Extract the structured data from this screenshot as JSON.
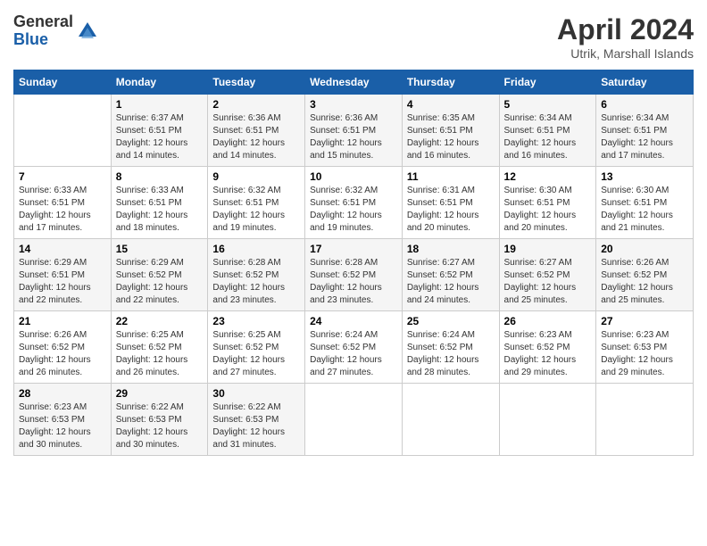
{
  "logo": {
    "general": "General",
    "blue": "Blue"
  },
  "title": "April 2024",
  "location": "Utrik, Marshall Islands",
  "days_of_week": [
    "Sunday",
    "Monday",
    "Tuesday",
    "Wednesday",
    "Thursday",
    "Friday",
    "Saturday"
  ],
  "weeks": [
    [
      {
        "num": "",
        "sunrise": "",
        "sunset": "",
        "daylight": ""
      },
      {
        "num": "1",
        "sunrise": "Sunrise: 6:37 AM",
        "sunset": "Sunset: 6:51 PM",
        "daylight": "Daylight: 12 hours and 14 minutes."
      },
      {
        "num": "2",
        "sunrise": "Sunrise: 6:36 AM",
        "sunset": "Sunset: 6:51 PM",
        "daylight": "Daylight: 12 hours and 14 minutes."
      },
      {
        "num": "3",
        "sunrise": "Sunrise: 6:36 AM",
        "sunset": "Sunset: 6:51 PM",
        "daylight": "Daylight: 12 hours and 15 minutes."
      },
      {
        "num": "4",
        "sunrise": "Sunrise: 6:35 AM",
        "sunset": "Sunset: 6:51 PM",
        "daylight": "Daylight: 12 hours and 16 minutes."
      },
      {
        "num": "5",
        "sunrise": "Sunrise: 6:34 AM",
        "sunset": "Sunset: 6:51 PM",
        "daylight": "Daylight: 12 hours and 16 minutes."
      },
      {
        "num": "6",
        "sunrise": "Sunrise: 6:34 AM",
        "sunset": "Sunset: 6:51 PM",
        "daylight": "Daylight: 12 hours and 17 minutes."
      }
    ],
    [
      {
        "num": "7",
        "sunrise": "Sunrise: 6:33 AM",
        "sunset": "Sunset: 6:51 PM",
        "daylight": "Daylight: 12 hours and 17 minutes."
      },
      {
        "num": "8",
        "sunrise": "Sunrise: 6:33 AM",
        "sunset": "Sunset: 6:51 PM",
        "daylight": "Daylight: 12 hours and 18 minutes."
      },
      {
        "num": "9",
        "sunrise": "Sunrise: 6:32 AM",
        "sunset": "Sunset: 6:51 PM",
        "daylight": "Daylight: 12 hours and 19 minutes."
      },
      {
        "num": "10",
        "sunrise": "Sunrise: 6:32 AM",
        "sunset": "Sunset: 6:51 PM",
        "daylight": "Daylight: 12 hours and 19 minutes."
      },
      {
        "num": "11",
        "sunrise": "Sunrise: 6:31 AM",
        "sunset": "Sunset: 6:51 PM",
        "daylight": "Daylight: 12 hours and 20 minutes."
      },
      {
        "num": "12",
        "sunrise": "Sunrise: 6:30 AM",
        "sunset": "Sunset: 6:51 PM",
        "daylight": "Daylight: 12 hours and 20 minutes."
      },
      {
        "num": "13",
        "sunrise": "Sunrise: 6:30 AM",
        "sunset": "Sunset: 6:51 PM",
        "daylight": "Daylight: 12 hours and 21 minutes."
      }
    ],
    [
      {
        "num": "14",
        "sunrise": "Sunrise: 6:29 AM",
        "sunset": "Sunset: 6:51 PM",
        "daylight": "Daylight: 12 hours and 22 minutes."
      },
      {
        "num": "15",
        "sunrise": "Sunrise: 6:29 AM",
        "sunset": "Sunset: 6:52 PM",
        "daylight": "Daylight: 12 hours and 22 minutes."
      },
      {
        "num": "16",
        "sunrise": "Sunrise: 6:28 AM",
        "sunset": "Sunset: 6:52 PM",
        "daylight": "Daylight: 12 hours and 23 minutes."
      },
      {
        "num": "17",
        "sunrise": "Sunrise: 6:28 AM",
        "sunset": "Sunset: 6:52 PM",
        "daylight": "Daylight: 12 hours and 23 minutes."
      },
      {
        "num": "18",
        "sunrise": "Sunrise: 6:27 AM",
        "sunset": "Sunset: 6:52 PM",
        "daylight": "Daylight: 12 hours and 24 minutes."
      },
      {
        "num": "19",
        "sunrise": "Sunrise: 6:27 AM",
        "sunset": "Sunset: 6:52 PM",
        "daylight": "Daylight: 12 hours and 25 minutes."
      },
      {
        "num": "20",
        "sunrise": "Sunrise: 6:26 AM",
        "sunset": "Sunset: 6:52 PM",
        "daylight": "Daylight: 12 hours and 25 minutes."
      }
    ],
    [
      {
        "num": "21",
        "sunrise": "Sunrise: 6:26 AM",
        "sunset": "Sunset: 6:52 PM",
        "daylight": "Daylight: 12 hours and 26 minutes."
      },
      {
        "num": "22",
        "sunrise": "Sunrise: 6:25 AM",
        "sunset": "Sunset: 6:52 PM",
        "daylight": "Daylight: 12 hours and 26 minutes."
      },
      {
        "num": "23",
        "sunrise": "Sunrise: 6:25 AM",
        "sunset": "Sunset: 6:52 PM",
        "daylight": "Daylight: 12 hours and 27 minutes."
      },
      {
        "num": "24",
        "sunrise": "Sunrise: 6:24 AM",
        "sunset": "Sunset: 6:52 PM",
        "daylight": "Daylight: 12 hours and 27 minutes."
      },
      {
        "num": "25",
        "sunrise": "Sunrise: 6:24 AM",
        "sunset": "Sunset: 6:52 PM",
        "daylight": "Daylight: 12 hours and 28 minutes."
      },
      {
        "num": "26",
        "sunrise": "Sunrise: 6:23 AM",
        "sunset": "Sunset: 6:52 PM",
        "daylight": "Daylight: 12 hours and 29 minutes."
      },
      {
        "num": "27",
        "sunrise": "Sunrise: 6:23 AM",
        "sunset": "Sunset: 6:53 PM",
        "daylight": "Daylight: 12 hours and 29 minutes."
      }
    ],
    [
      {
        "num": "28",
        "sunrise": "Sunrise: 6:23 AM",
        "sunset": "Sunset: 6:53 PM",
        "daylight": "Daylight: 12 hours and 30 minutes."
      },
      {
        "num": "29",
        "sunrise": "Sunrise: 6:22 AM",
        "sunset": "Sunset: 6:53 PM",
        "daylight": "Daylight: 12 hours and 30 minutes."
      },
      {
        "num": "30",
        "sunrise": "Sunrise: 6:22 AM",
        "sunset": "Sunset: 6:53 PM",
        "daylight": "Daylight: 12 hours and 31 minutes."
      },
      {
        "num": "",
        "sunrise": "",
        "sunset": "",
        "daylight": ""
      },
      {
        "num": "",
        "sunrise": "",
        "sunset": "",
        "daylight": ""
      },
      {
        "num": "",
        "sunrise": "",
        "sunset": "",
        "daylight": ""
      },
      {
        "num": "",
        "sunrise": "",
        "sunset": "",
        "daylight": ""
      }
    ]
  ]
}
